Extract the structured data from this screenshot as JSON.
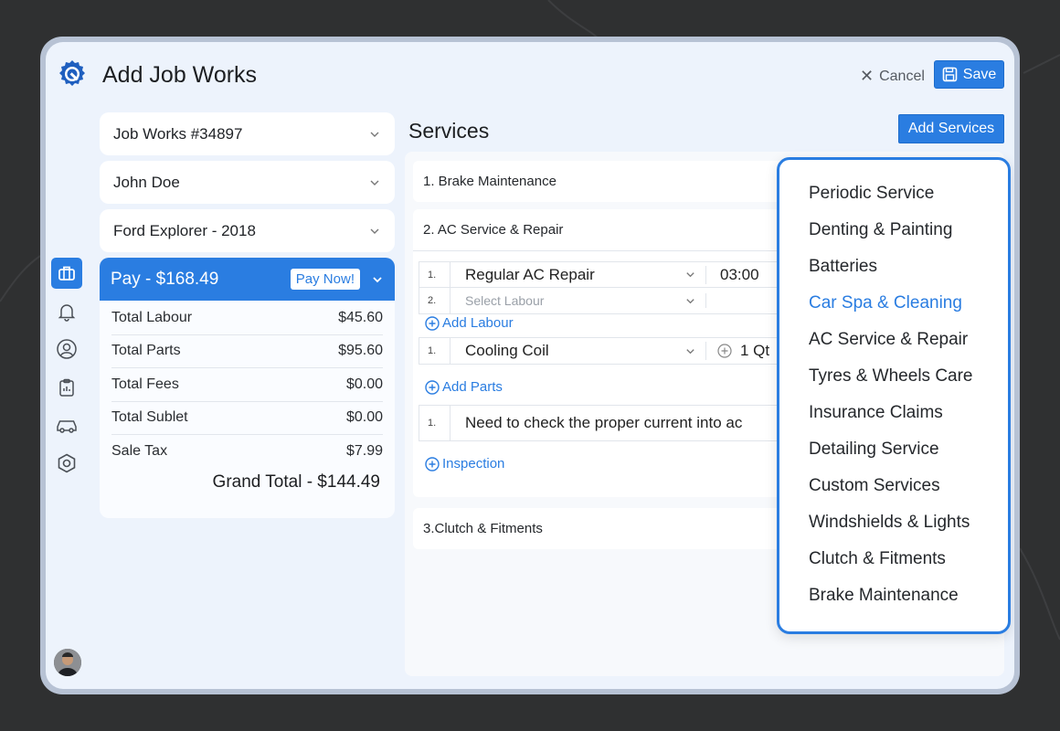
{
  "header": {
    "title": "Add Job Works",
    "cancel_label": "Cancel",
    "save_label": "Save"
  },
  "left": {
    "job_select": "Job Works #34897",
    "customer_select": "John Doe",
    "vehicle_select": "Ford Explorer - 2018",
    "pay": {
      "label": "Pay - $168.49",
      "pay_now": "Pay Now!",
      "rows": [
        {
          "label": "Total Labour",
          "value": "$45.60"
        },
        {
          "label": "Total Parts",
          "value": "$95.60"
        },
        {
          "label": "Total Fees",
          "value": "$0.00"
        },
        {
          "label": "Total Sublet",
          "value": "$0.00"
        },
        {
          "label": "Sale Tax",
          "value": "$7.99"
        }
      ],
      "grand_total": "Grand Total - $144.49"
    }
  },
  "services": {
    "title": "Services",
    "add_button": "Add Services",
    "items": [
      {
        "label": "1. Brake Maintenance"
      },
      {
        "label": "2. AC Service & Repair"
      },
      {
        "label": "3.Clutch & Fitments"
      }
    ],
    "labour": [
      {
        "num": "1.",
        "name": "Regular AC Repair",
        "time": "03:00"
      },
      {
        "num": "2.",
        "placeholder": "Select Labour"
      }
    ],
    "add_labour": "Add Labour",
    "parts": [
      {
        "num": "1.",
        "name": "Cooling Coil",
        "qty": "1 Qt"
      }
    ],
    "add_parts": "Add Parts",
    "notes": [
      {
        "num": "1.",
        "text": "Need to check the proper current into ac"
      }
    ],
    "inspection": "Inspection"
  },
  "dropdown": {
    "items": [
      "Periodic Service",
      "Denting & Painting",
      "Batteries",
      "Car Spa & Cleaning",
      "AC Service & Repair",
      "Tyres & Wheels Care",
      "Insurance Claims",
      "Detailing Service",
      "Custom Services",
      "Windshields & Lights",
      "Clutch & Fitments",
      "Brake Maintenance"
    ],
    "active_index": 3
  },
  "colors": {
    "accent": "#2a7de1",
    "background": "#2f3031",
    "window": "#edf3fc"
  }
}
